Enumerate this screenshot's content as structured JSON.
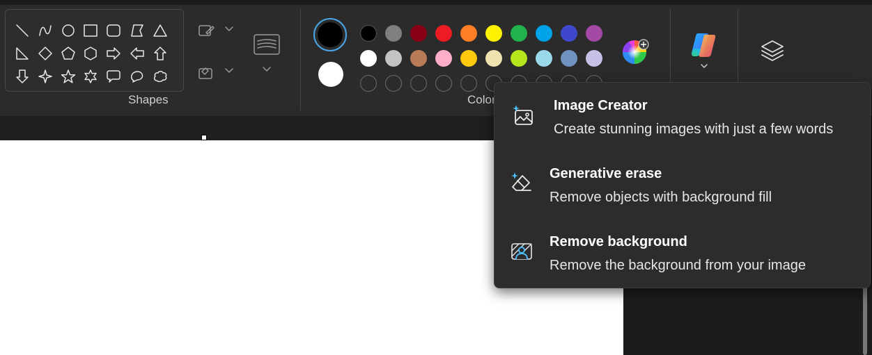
{
  "ribbon": {
    "shapes_label": "Shapes",
    "colors_label": "Colors",
    "shape_icons": [
      "line-icon",
      "curve-icon",
      "oval-icon",
      "rectangle-icon",
      "rounded-rectangle-icon",
      "polygon-icon",
      "triangle-icon",
      "right-triangle-icon",
      "diamond-icon",
      "pentagon-icon",
      "hexagon-icon",
      "right-arrow-icon",
      "left-arrow-icon",
      "up-arrow-icon",
      "down-arrow-icon",
      "four-point-star-icon",
      "five-point-star-icon",
      "six-point-star-icon",
      "rounded-callout-icon",
      "oval-callout-icon",
      "cloud-callout-icon",
      "heart-icon",
      "lightning-icon"
    ],
    "tool_icons": [
      "outline-icon",
      "fill-icon",
      "size-icon",
      "copilot-icon",
      "layers-icon",
      "edit-colors-icon"
    ]
  },
  "colors": {
    "color1": "#000000",
    "color2": "#ffffff",
    "row1": [
      "#000000",
      "#7f7f7f",
      "#880015",
      "#ed1c24",
      "#ff7f27",
      "#fff200",
      "#22b14c",
      "#00a2e8",
      "#3f48cc",
      "#a349a4"
    ],
    "row2": [
      "#ffffff",
      "#c3c3c3",
      "#b97a57",
      "#ffaec9",
      "#ffc90e",
      "#efe4b0",
      "#b5e61d",
      "#99d9ea",
      "#7092be",
      "#c8bfe7"
    ],
    "row3_empty_count": 10
  },
  "copilot_menu": {
    "items": [
      {
        "title": "Image Creator",
        "description": "Create stunning images with just a few words",
        "icon": "image-sparkle-icon"
      },
      {
        "title": "Generative erase",
        "description": "Remove objects with background fill",
        "icon": "eraser-sparkle-icon"
      },
      {
        "title": "Remove background",
        "description": "Remove the background from your image",
        "icon": "remove-background-icon"
      }
    ]
  }
}
